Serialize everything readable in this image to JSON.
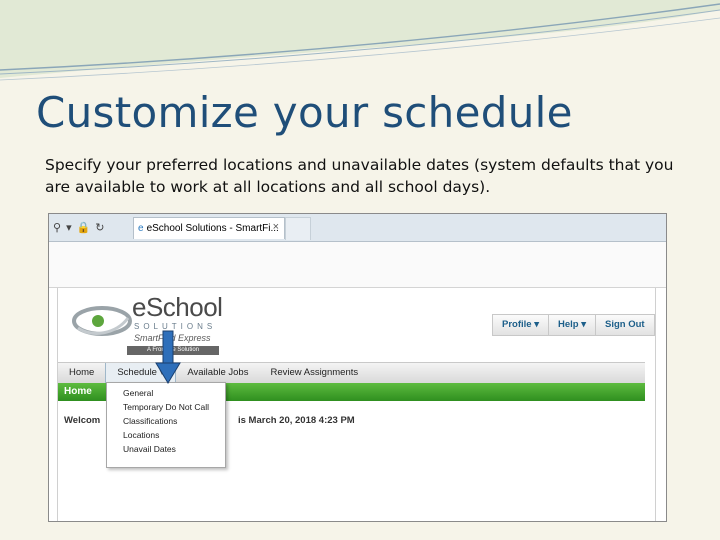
{
  "slide": {
    "title": "Customize your schedule",
    "subtitle": "Specify your preferred locations and unavailable dates (system defaults that you are available to work at all locations and all school days)."
  },
  "browser": {
    "search_icon": "search-icon",
    "dropdown_icon": "chevron-down-icon",
    "lock_icon": "lock-icon",
    "refresh_icon": "refresh-icon",
    "tab_title": "eSchool Solutions - SmartFi...",
    "tab_close": "×"
  },
  "app": {
    "logo": {
      "brand": "eSchool",
      "solutions": "SOLUTIONS",
      "product": "SmartFind Express",
      "tagline": "A Frontline Solution"
    },
    "userbar": {
      "profile": "Profile ▾",
      "help": "Help ▾",
      "signout": "Sign Out"
    },
    "nav": {
      "home": "Home",
      "schedule": "Schedule ▾",
      "available_jobs": "Available Jobs",
      "review_assignments": "Review Assignments"
    },
    "greenbar": {
      "label": "Home"
    },
    "welcome": "Welcom",
    "date": "is  March 20, 2018 4:23 PM",
    "schedule_menu": [
      "General",
      "Temporary Do Not Call",
      "Classifications",
      "Locations",
      "Unavail Dates"
    ]
  },
  "colors": {
    "title": "#1f4e79",
    "green_bar": "#3a9a28",
    "arrow": "#2e6fba",
    "link": "#1d5f8a"
  }
}
